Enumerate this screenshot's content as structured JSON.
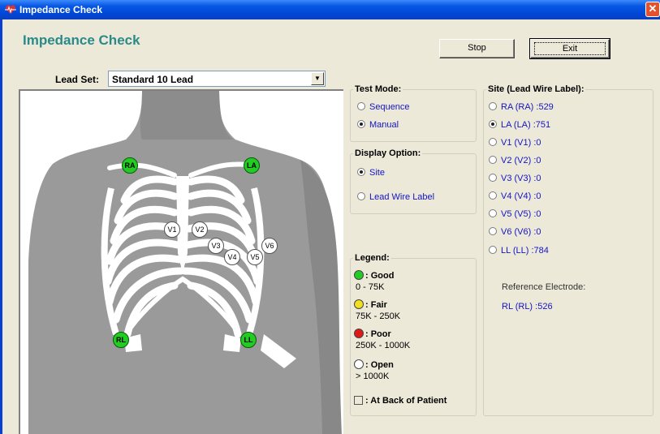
{
  "window": {
    "title": "Impedance Check"
  },
  "heading": "Impedance Check",
  "buttons": {
    "stop": "Stop",
    "exit": "Exit"
  },
  "lead_set": {
    "label": "Lead Set:",
    "value": "Standard 10 Lead"
  },
  "electrodes": {
    "RA": "RA",
    "LA": "LA",
    "RL": "RL",
    "LL": "LL",
    "V1": "V1",
    "V2": "V2",
    "V3": "V3",
    "V4": "V4",
    "V5": "V5",
    "V6": "V6"
  },
  "test_mode": {
    "title": "Test Mode:",
    "options": [
      {
        "label": "Sequence",
        "selected": false
      },
      {
        "label": "Manual",
        "selected": true
      }
    ]
  },
  "display_option": {
    "title": "Display Option:",
    "options": [
      {
        "label": "Site",
        "selected": true
      },
      {
        "label": "Lead Wire Label",
        "selected": false
      }
    ]
  },
  "legend": {
    "title": "Legend:",
    "items": [
      {
        "name": ": Good",
        "range": "0 - 75K",
        "color": "#22cc22"
      },
      {
        "name": ": Fair",
        "range": "75K - 250K",
        "color": "#f0e020"
      },
      {
        "name": ": Poor",
        "range": "250K - 1000K",
        "color": "#e01818"
      },
      {
        "name": ": Open",
        "range": "> 1000K",
        "color": "#ffffff"
      }
    ],
    "back_of_patient": ": At Back of Patient"
  },
  "site_panel": {
    "title": "Site (Lead Wire Label):",
    "sites": [
      {
        "label": "RA (RA) :529",
        "selected": false
      },
      {
        "label": "LA (LA) :751",
        "selected": true
      },
      {
        "label": "V1 (V1) :0",
        "selected": false
      },
      {
        "label": "V2 (V2) :0",
        "selected": false
      },
      {
        "label": "V3 (V3) :0",
        "selected": false
      },
      {
        "label": "V4 (V4) :0",
        "selected": false
      },
      {
        "label": "V5 (V5) :0",
        "selected": false
      },
      {
        "label": "V6 (V6) :0",
        "selected": false
      },
      {
        "label": "LL (LL) :784",
        "selected": false
      }
    ],
    "reference_label": "Reference Electrode:",
    "reference_value": "RL (RL) :526"
  }
}
